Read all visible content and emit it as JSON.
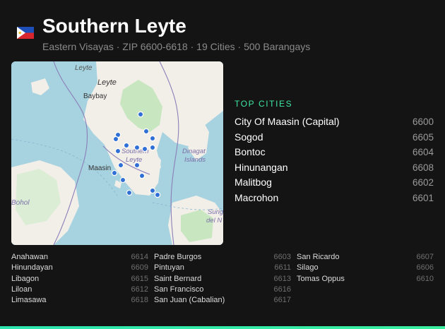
{
  "header": {
    "flag_icon": "philippines-flag-icon",
    "title": "Southern Leyte",
    "subtitle": "Eastern Visayas · ZIP 6600-6618 · 19 Cities · 500 Barangays"
  },
  "map": {
    "labels": {
      "leyte_top": "Leyte",
      "leyte_island": "Leyte",
      "baybay": "Baybay",
      "southern_line1": "Southern",
      "southern_line2": "Leyte",
      "maasin": "Maasin",
      "dinagat_line1": "Dinagat",
      "dinagat_line2": "Islands",
      "bohol": "Bohol",
      "surigao_line1": "Surig",
      "surigao_line2": "del N"
    },
    "colors": {
      "water": "#a7d2df",
      "land": "#f2efe9",
      "green": "#c8e6c0",
      "marker": "#2f6fd6"
    }
  },
  "top_cities": {
    "heading": "TOP CITIES",
    "items": [
      {
        "name": "City Of Maasin (Capital)",
        "zip": "6600"
      },
      {
        "name": "Sogod",
        "zip": "6605"
      },
      {
        "name": "Bontoc",
        "zip": "6604"
      },
      {
        "name": "Hinunangan",
        "zip": "6608"
      },
      {
        "name": "Malitbog",
        "zip": "6602"
      },
      {
        "name": "Macrohon",
        "zip": "6601"
      }
    ]
  },
  "cities": {
    "col1": [
      {
        "name": "Anahawan",
        "zip": "6614"
      },
      {
        "name": "Hinundayan",
        "zip": "6609"
      },
      {
        "name": "Libagon",
        "zip": "6615"
      },
      {
        "name": "Liloan",
        "zip": "6612"
      },
      {
        "name": "Limasawa",
        "zip": "6618"
      }
    ],
    "col2": [
      {
        "name": "Padre Burgos",
        "zip": "6603"
      },
      {
        "name": "Pintuyan",
        "zip": "6611"
      },
      {
        "name": "Saint Bernard",
        "zip": "6613"
      },
      {
        "name": "San Francisco",
        "zip": "6616"
      },
      {
        "name": "San Juan (Cabalian)",
        "zip": "6617"
      }
    ],
    "col3": [
      {
        "name": "San Ricardo",
        "zip": "6607"
      },
      {
        "name": "Silago",
        "zip": "6606"
      },
      {
        "name": "Tomas Oppus",
        "zip": "6610"
      }
    ]
  }
}
